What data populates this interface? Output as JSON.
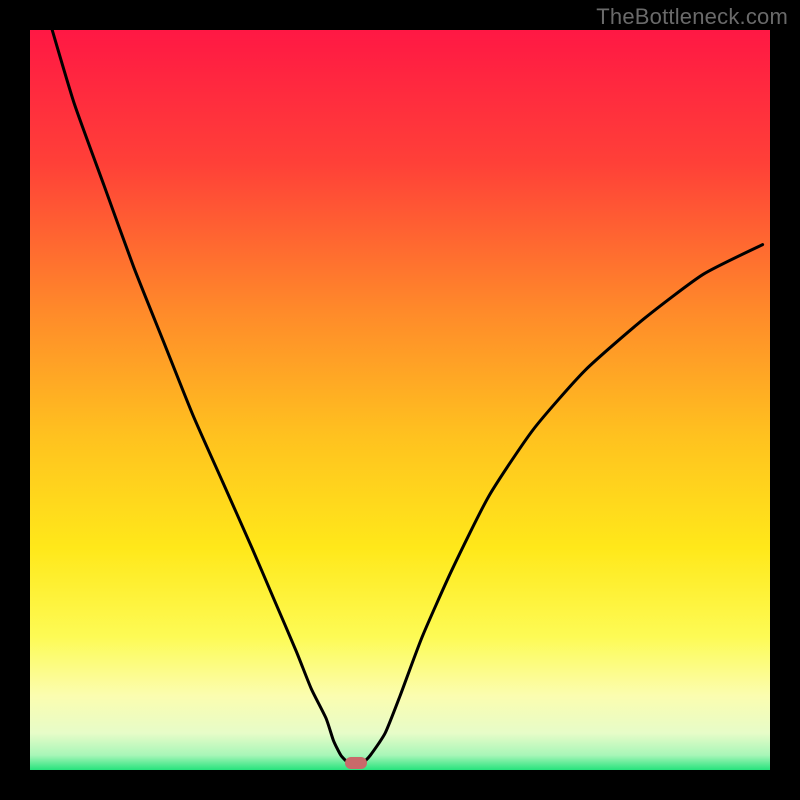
{
  "watermark": "TheBottleneck.com",
  "colors": {
    "frame": "#000000",
    "marker": "#c96a6a",
    "curve": "#000000",
    "gradient_stops": [
      {
        "pct": 0,
        "color": "#ff1844"
      },
      {
        "pct": 18,
        "color": "#ff4038"
      },
      {
        "pct": 38,
        "color": "#ff8a2a"
      },
      {
        "pct": 55,
        "color": "#ffc21f"
      },
      {
        "pct": 70,
        "color": "#ffe81a"
      },
      {
        "pct": 82,
        "color": "#fdfb55"
      },
      {
        "pct": 90,
        "color": "#fbfdb0"
      },
      {
        "pct": 95,
        "color": "#e7fcc8"
      },
      {
        "pct": 98,
        "color": "#a8f6b8"
      },
      {
        "pct": 100,
        "color": "#27e37d"
      }
    ]
  },
  "chart_data": {
    "type": "line",
    "title": "",
    "xlabel": "",
    "ylabel": "",
    "xlim": [
      0,
      100
    ],
    "ylim": [
      0,
      100
    ],
    "marker": {
      "x": 44,
      "y": 1
    },
    "series": [
      {
        "name": "bottleneck-curve",
        "x": [
          3,
          6,
          10,
          14,
          18,
          22,
          26,
          30,
          33,
          36,
          38,
          40,
          41,
          42,
          43,
          44,
          45,
          46,
          48,
          50,
          53,
          57,
          62,
          68,
          75,
          83,
          91,
          99
        ],
        "y": [
          100,
          90,
          79,
          68,
          58,
          48,
          39,
          30,
          23,
          16,
          11,
          7,
          4,
          2,
          1,
          1,
          1,
          2,
          5,
          10,
          18,
          27,
          37,
          46,
          54,
          61,
          67,
          71
        ]
      }
    ]
  }
}
